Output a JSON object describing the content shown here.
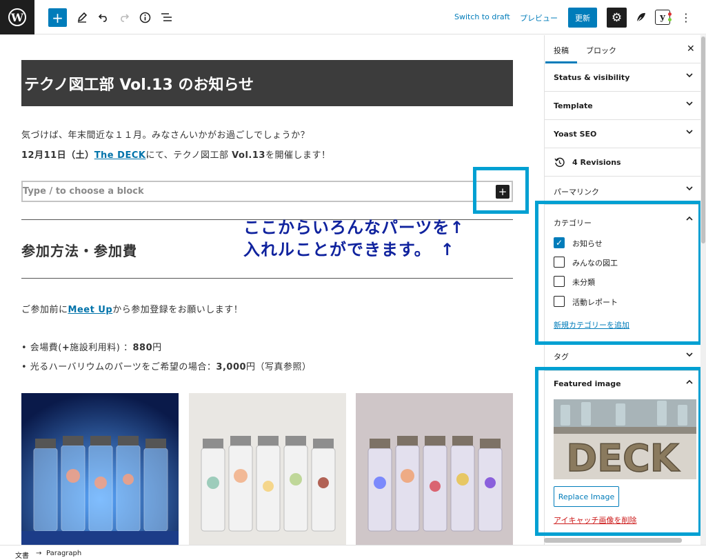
{
  "toolbar": {
    "switch_draft": "Switch to draft",
    "preview": "プレビュー",
    "update": "更新"
  },
  "post": {
    "title": "テクノ図工部 Vol.13 のお知らせ",
    "para1": "気づけば、年末間近な１１月。みなさんいかがお過ごしでしょうか？",
    "para2_pre": "12月11日（土）",
    "para2_link": "The DECK",
    "para2_post": "にて、テクノ図工部 ",
    "para2_bold": "Vol.13",
    "para2_end": "を開催します！",
    "appender_placeholder": "Type / to choose a block",
    "heading": "参加方法・参加費",
    "para3_pre": "ご参加前に",
    "para3_link": "Meet Up",
    "para3_post": "から参加登録をお願いします！",
    "bullet1_pre": "• 会場費(",
    "bullet1_bold": "+",
    "bullet1_mid": "施設利用料) ：",
    "bullet1_price": "880",
    "bullet1_unit": "円",
    "bullet2_pre": "• 光るハーバリウムのパーツをご希望の場合：",
    "bullet2_price": "3,000",
    "bullet2_unit": "円（写真参照）"
  },
  "annotation": {
    "line1": "ここからいろんなパーツを↑",
    "line2": "入れルことができます。　↑"
  },
  "sidebar": {
    "tab_post": "投稿",
    "tab_block": "ブロック",
    "status_visibility": "Status & visibility",
    "template": "Template",
    "yoast": "Yoast SEO",
    "revisions": "4 Revisions",
    "permalink": "パーマリンク",
    "categories_title": "カテゴリー",
    "categories": [
      {
        "label": "お知らせ",
        "checked": true
      },
      {
        "label": "みんなの図工",
        "checked": false
      },
      {
        "label": "未分類",
        "checked": false
      },
      {
        "label": "活動レポート",
        "checked": false
      }
    ],
    "add_category": "新規カテゴリーを追加",
    "tags": "タグ",
    "featured_image": "Featured image",
    "replace_image": "Replace Image",
    "remove_image": "アイキャッチ画像を削除",
    "featured_image_sign": "DECK"
  },
  "footer": {
    "crumb_root": "文書",
    "crumb_arrow": "→",
    "crumb_current": "Paragraph"
  },
  "colors": {
    "accent": "#007cba",
    "highlight": "#00a0d2",
    "annotation": "#10239e",
    "danger": "#cc1818"
  }
}
